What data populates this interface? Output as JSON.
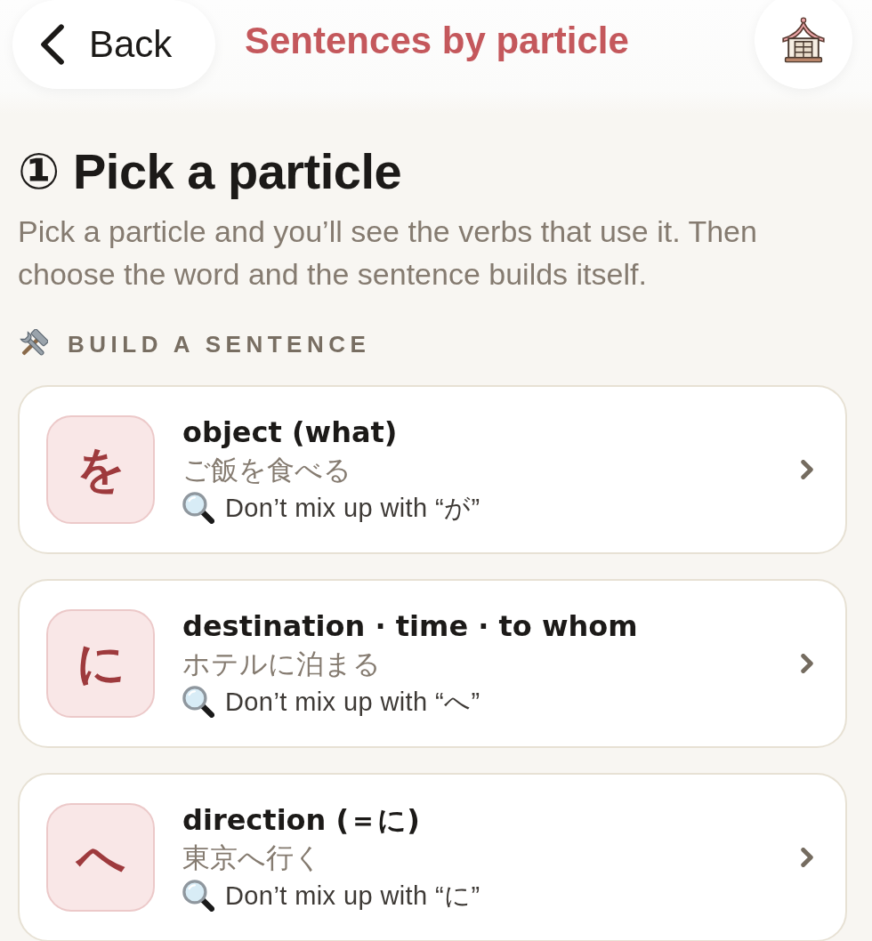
{
  "header": {
    "back_button": {
      "label": "Back"
    },
    "title": "Sentences by particle"
  },
  "step": {
    "heading": "① Pick a particle",
    "description": "Pick a particle and you’ll see the verbs that use it. Then choose the word and the sentence builds itself."
  },
  "section": {
    "label": "BUILD A SENTENCE"
  },
  "particles": [
    {
      "particle": "を",
      "title": "object (what)",
      "example": "ご飯を食べる",
      "note": "Don’t mix up with “が”"
    },
    {
      "particle": "に",
      "title": "destination · time · to whom",
      "example": "ホテルに泊まる",
      "note": "Don’t mix up with “へ”"
    },
    {
      "particle": "へ",
      "title": "direction (＝に)",
      "example": "東京へ行く",
      "note": "Don’t mix up with “に”"
    }
  ]
}
